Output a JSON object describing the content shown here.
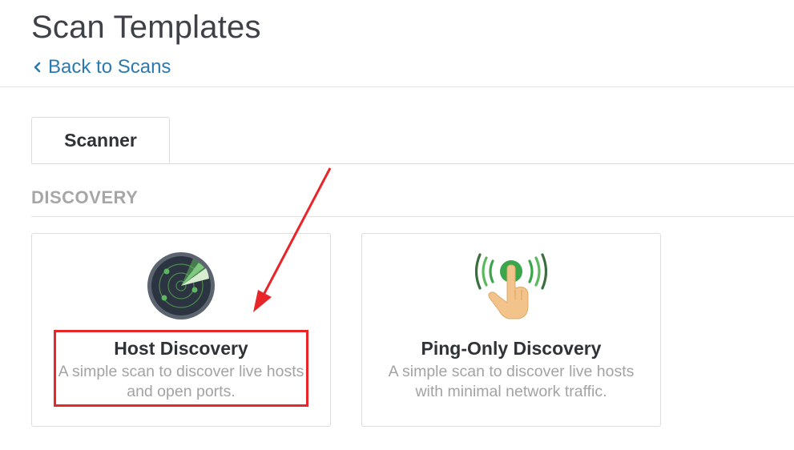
{
  "header": {
    "title": "Scan Templates",
    "back_link": "Back to Scans"
  },
  "tabs": [
    {
      "label": "Scanner",
      "active": true
    }
  ],
  "section": {
    "heading": "DISCOVERY"
  },
  "templates": [
    {
      "title": "Host Discovery",
      "description": "A simple scan to discover live hosts and open ports.",
      "icon": "radar-icon"
    },
    {
      "title": "Ping-Only Discovery",
      "description": "A simple scan to discover live hosts with minimal network traffic.",
      "icon": "ping-touch-icon"
    }
  ],
  "annotation": {
    "color": "#e8262a",
    "target": "Host Discovery"
  },
  "colors": {
    "link": "#2a7ab0",
    "title": "#3e4147",
    "muted": "#a3a3a3",
    "radar_green": "#5cb85c",
    "ping_green": "#3aa64a",
    "annotation_red": "#e8262a"
  }
}
